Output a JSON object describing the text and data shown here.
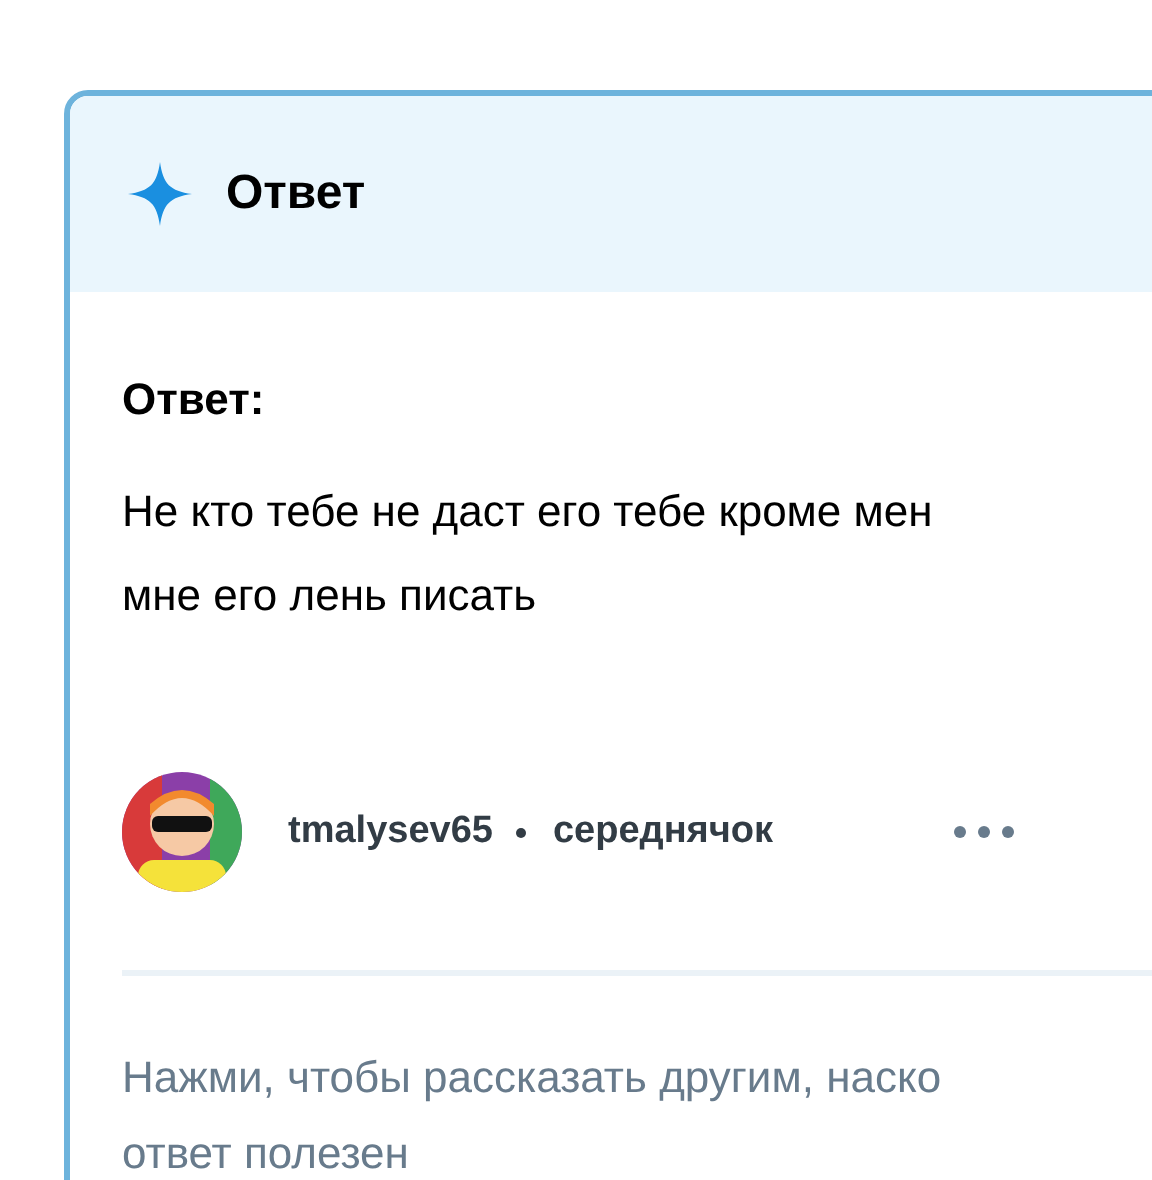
{
  "card": {
    "title": "Ответ"
  },
  "answer": {
    "label": "Ответ:",
    "lines": [
      "Не кто тебе не даст его тебе кроме мен",
      "мне его лень писать"
    ]
  },
  "author": {
    "username": "tmalysev65",
    "rank": "середнячок"
  },
  "rating_prompt": {
    "lines": [
      "Нажми, чтобы рассказать другим, наско",
      "ответ полезен"
    ]
  }
}
